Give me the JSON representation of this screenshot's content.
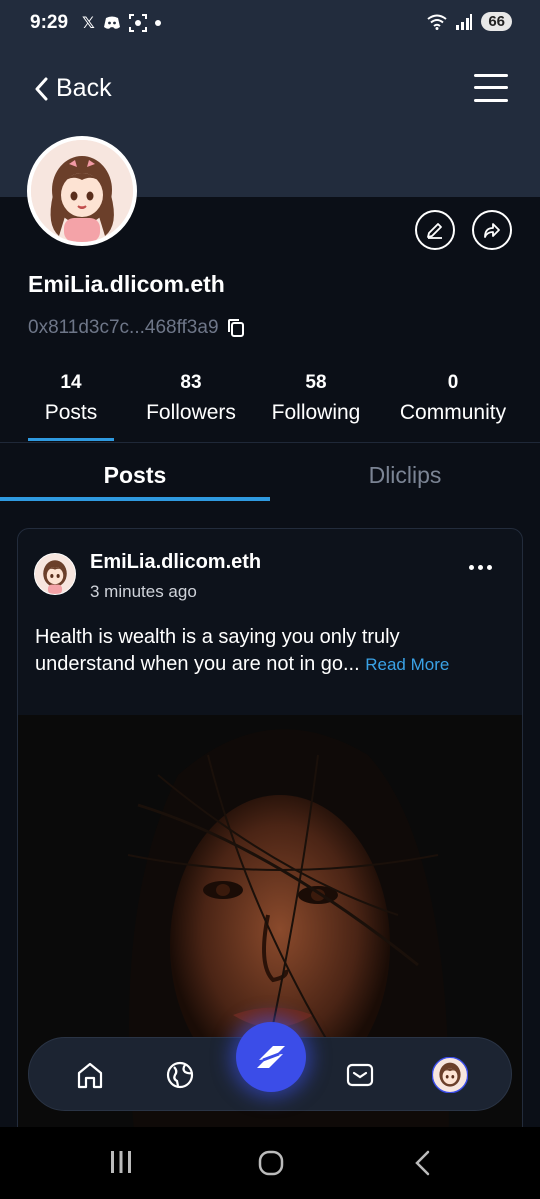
{
  "status_bar": {
    "time": "9:29",
    "left_icons": [
      "x-icon",
      "discord-icon",
      "screenshot-icon",
      "dot-icon"
    ],
    "battery": "66"
  },
  "header": {
    "back_label": "Back"
  },
  "profile": {
    "username": "EmiLia.dlicom.eth",
    "wallet": "0x811d3c7c...468ff3a9"
  },
  "stats": [
    {
      "count": "14",
      "label": "Posts"
    },
    {
      "count": "83",
      "label": "Followers"
    },
    {
      "count": "58",
      "label": "Following"
    },
    {
      "count": "0",
      "label": "Community"
    }
  ],
  "tabs": [
    {
      "label": "Posts",
      "active": true
    },
    {
      "label": "Dliclips",
      "active": false
    }
  ],
  "post": {
    "author": "EmiLia.dlicom.eth",
    "time": "3 minutes ago",
    "text": "Health is wealth is a saying  you only truly understand  when you are not in go...",
    "read_more": "Read More"
  },
  "colors": {
    "accent": "#2f9ae0",
    "header_bg": "#222c3d",
    "page_bg": "#0b0f17",
    "nav_center": "#3b4de8"
  },
  "bottom_nav": [
    "home-icon",
    "globe-icon",
    "dlicom-logo-icon",
    "inbox-icon",
    "profile-avatar"
  ]
}
